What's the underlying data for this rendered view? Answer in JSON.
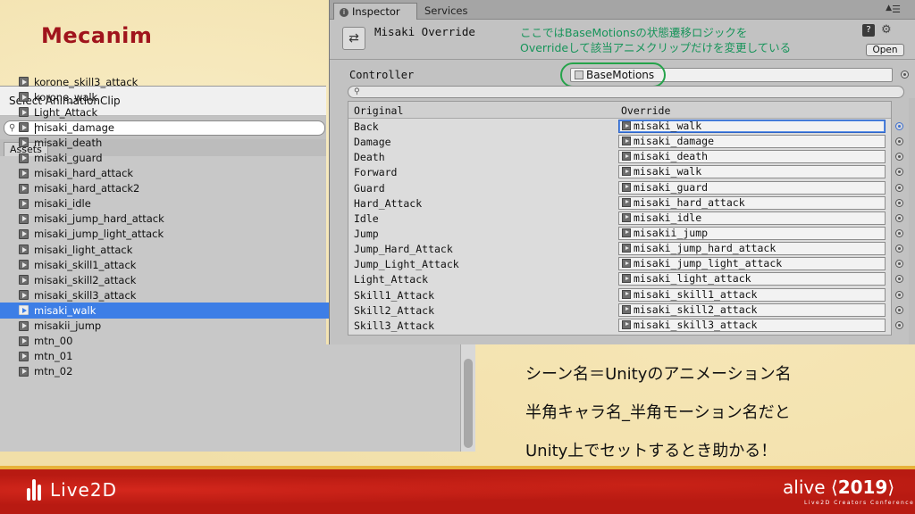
{
  "slide": {
    "title": "Mecanim",
    "caption_lines": [
      "シーン名＝Unityのアニメーション名",
      "半角キャラ名_半角モーション名だと",
      "Unity上でセットするとき助かる！"
    ]
  },
  "picker": {
    "title": "Select AnimationClip",
    "search_value": "",
    "tab_assets": "Assets",
    "items": [
      "korone_skill3_attack",
      "korone_walk",
      "Light_Attack",
      "misaki_damage",
      "misaki_death",
      "misaki_guard",
      "misaki_hard_attack",
      "misaki_hard_attack2",
      "misaki_idle",
      "misaki_jump_hard_attack",
      "misaki_jump_light_attack",
      "misaki_light_attack",
      "misaki_skill1_attack",
      "misaki_skill2_attack",
      "misaki_skill3_attack",
      "misaki_walk",
      "misakii_jump",
      "mtn_00",
      "mtn_01",
      "mtn_02"
    ],
    "selected_item": "misaki_walk"
  },
  "inspector": {
    "tabs": {
      "inspector": "Inspector",
      "services": "Services"
    },
    "object_name": "Misaki Override",
    "open_label": "Open",
    "annotation_line1": "ここではBaseMotionsの状態遷移ロジックを",
    "annotation_line2": "Overrideして該当アニメクリップだけを変更している",
    "controller_label": "Controller",
    "controller_value": "BaseMotions",
    "col_original": "Original",
    "col_override": "Override",
    "rows": [
      {
        "original": "Back",
        "override": "misaki_walk"
      },
      {
        "original": "Damage",
        "override": "misaki_damage"
      },
      {
        "original": "Death",
        "override": "misaki_death"
      },
      {
        "original": "Forward",
        "override": "misaki_walk"
      },
      {
        "original": "Guard",
        "override": "misaki_guard"
      },
      {
        "original": "Hard_Attack",
        "override": "misaki_hard_attack"
      },
      {
        "original": "Idle",
        "override": "misaki_idle"
      },
      {
        "original": "Jump",
        "override": "misakii_jump"
      },
      {
        "original": "Jump_Hard_Attack",
        "override": "misaki_jump_hard_attack"
      },
      {
        "original": "Jump_Light_Attack",
        "override": "misaki_jump_light_attack"
      },
      {
        "original": "Light_Attack",
        "override": "misaki_light_attack"
      },
      {
        "original": "Skill1_Attack",
        "override": "misaki_skill1_attack"
      },
      {
        "original": "Skill2_Attack",
        "override": "misaki_skill2_attack"
      },
      {
        "original": "Skill3_Attack",
        "override": "misaki_skill3_attack"
      }
    ]
  },
  "footer": {
    "left_logo": "Live2D",
    "right_logo_prefix": "alive",
    "right_logo_year": "2019",
    "right_logo_sub": "Live2D Creators Conference"
  },
  "colors": {
    "title_red": "#a0141c",
    "annotation_green": "#17945a",
    "selection_blue": "#3d7ee6",
    "footer_red": "#b81a12"
  },
  "icons": {
    "clip": "animation-clip-icon",
    "controller": "animator-controller-icon",
    "picker": "object-picker-icon",
    "help": "help-icon",
    "gear": "gear-icon",
    "search": "search-icon"
  }
}
